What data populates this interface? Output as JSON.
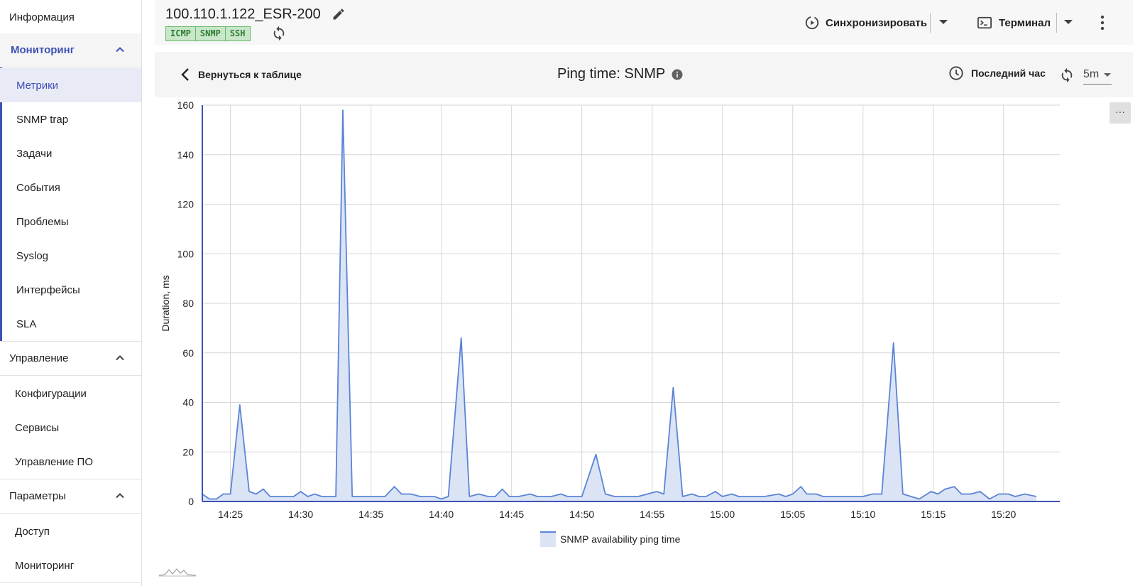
{
  "sidebar": {
    "info": "Информация",
    "monitoring": {
      "title": "Мониторинг",
      "items": [
        "Метрики",
        "SNMP trap",
        "Задачи",
        "События",
        "Проблемы",
        "Syslog",
        "Интерфейсы",
        "SLA"
      ]
    },
    "management": {
      "title": "Управление",
      "items": [
        "Конфигурации",
        "Сервисы",
        "Управление ПО"
      ]
    },
    "parameters": {
      "title": "Параметры",
      "items": [
        "Доступ",
        "Мониторинг"
      ]
    }
  },
  "header": {
    "device_title": "100.110.1.122_ESR-200",
    "badges": [
      "ICMP",
      "SNMP",
      "SSH"
    ],
    "sync_label": "Синхронизировать",
    "terminal_label": "Терминал"
  },
  "toolbar": {
    "back_label": "Вернуться к таблице",
    "chart_title": "Ping time: SNMP",
    "range_label": "Последний час",
    "interval_value": "5m"
  },
  "chart_menu_label": "···",
  "colors": {
    "accent": "#3f51b5",
    "series_line": "#5b84d6",
    "series_fill": "#dbe4f5",
    "badge_bg": "#c8e6c9",
    "badge_border": "#66bb6a"
  },
  "chart_data": {
    "type": "area",
    "ylabel": "Duration, ms",
    "xlabel": "",
    "ylim": [
      0,
      160
    ],
    "yticks": [
      0,
      20,
      40,
      60,
      80,
      100,
      120,
      140,
      160
    ],
    "xlim": [
      "14:23",
      "15:24"
    ],
    "xticks": [
      "14:25",
      "14:30",
      "14:35",
      "14:40",
      "14:45",
      "14:50",
      "14:55",
      "15:00",
      "15:05",
      "15:10",
      "15:15",
      "15:20"
    ],
    "grid": true,
    "legend_position": "bottom-center",
    "series": [
      {
        "name": "SNMP availability ping time",
        "points": [
          [
            "14:23:00",
            3
          ],
          [
            "14:23:30",
            1
          ],
          [
            "14:24:00",
            1
          ],
          [
            "14:24:30",
            3
          ],
          [
            "14:25:00",
            3
          ],
          [
            "14:25:40",
            39
          ],
          [
            "14:26:20",
            4
          ],
          [
            "14:26:50",
            3
          ],
          [
            "14:27:20",
            5
          ],
          [
            "14:27:50",
            2
          ],
          [
            "14:28:30",
            2
          ],
          [
            "14:29:30",
            2
          ],
          [
            "14:30:00",
            4
          ],
          [
            "14:30:30",
            2
          ],
          [
            "14:31:00",
            3
          ],
          [
            "14:31:30",
            2
          ],
          [
            "14:32:30",
            2
          ],
          [
            "14:33:00",
            158
          ],
          [
            "14:33:40",
            2
          ],
          [
            "14:35:00",
            2
          ],
          [
            "14:36:00",
            2
          ],
          [
            "14:36:40",
            6
          ],
          [
            "14:37:10",
            3
          ],
          [
            "14:37:50",
            3
          ],
          [
            "14:38:30",
            2
          ],
          [
            "14:39:30",
            2
          ],
          [
            "14:40:00",
            1
          ],
          [
            "14:40:30",
            2
          ],
          [
            "14:41:25",
            66
          ],
          [
            "14:42:00",
            2
          ],
          [
            "14:42:40",
            3
          ],
          [
            "14:43:20",
            2
          ],
          [
            "14:43:50",
            2
          ],
          [
            "14:44:20",
            5
          ],
          [
            "14:44:50",
            2
          ],
          [
            "14:45:30",
            2
          ],
          [
            "14:46:20",
            3
          ],
          [
            "14:46:50",
            2
          ],
          [
            "14:47:50",
            2
          ],
          [
            "14:48:30",
            3
          ],
          [
            "14:49:00",
            2
          ],
          [
            "14:50:00",
            2
          ],
          [
            "14:51:00",
            19
          ],
          [
            "14:51:40",
            3
          ],
          [
            "14:52:20",
            2
          ],
          [
            "14:54:00",
            2
          ],
          [
            "14:55:20",
            4
          ],
          [
            "14:55:50",
            3
          ],
          [
            "14:56:30",
            46
          ],
          [
            "14:57:10",
            2
          ],
          [
            "14:57:50",
            3
          ],
          [
            "14:58:20",
            2
          ],
          [
            "14:58:50",
            2
          ],
          [
            "14:59:30",
            4
          ],
          [
            "15:00:00",
            2
          ],
          [
            "15:00:40",
            3
          ],
          [
            "15:01:10",
            2
          ],
          [
            "15:03:00",
            2
          ],
          [
            "15:04:00",
            3
          ],
          [
            "15:04:30",
            2
          ],
          [
            "15:05:00",
            3
          ],
          [
            "15:05:35",
            6
          ],
          [
            "15:06:00",
            3
          ],
          [
            "15:06:40",
            3
          ],
          [
            "15:07:10",
            2
          ],
          [
            "15:10:00",
            2
          ],
          [
            "15:10:40",
            3
          ],
          [
            "15:11:20",
            3
          ],
          [
            "15:12:10",
            64
          ],
          [
            "15:12:50",
            3
          ],
          [
            "15:14:00",
            1
          ],
          [
            "15:14:50",
            4
          ],
          [
            "15:15:20",
            3
          ],
          [
            "15:15:50",
            5
          ],
          [
            "15:16:30",
            6
          ],
          [
            "15:17:00",
            3
          ],
          [
            "15:17:40",
            3
          ],
          [
            "15:18:20",
            4
          ],
          [
            "15:19:00",
            1
          ],
          [
            "15:19:40",
            3
          ],
          [
            "15:20:20",
            3
          ],
          [
            "15:20:50",
            2
          ],
          [
            "15:21:30",
            3
          ],
          [
            "15:22:20",
            2
          ]
        ]
      }
    ]
  }
}
